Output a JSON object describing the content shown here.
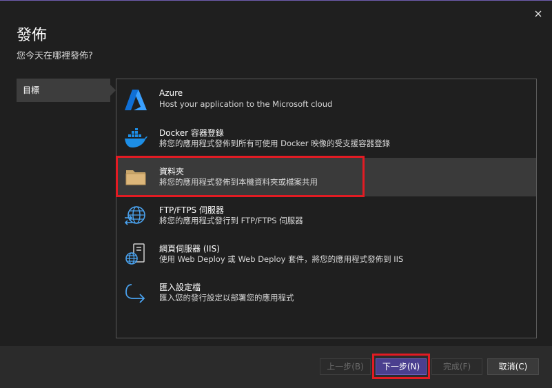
{
  "dialog": {
    "title": "發佈",
    "subtitle": "您今天在哪裡發佈?"
  },
  "nav": {
    "items": [
      {
        "label": "目標"
      }
    ]
  },
  "targets": [
    {
      "name": "Azure",
      "desc": "Host your application to the Microsoft cloud",
      "icon": "azure-icon"
    },
    {
      "name": "Docker 容器登錄",
      "desc": "將您的應用程式發佈到所有可使用 Docker 映像的受支援容器登錄",
      "icon": "docker-icon"
    },
    {
      "name": "資料夾",
      "desc": "將您的應用程式發佈到本機資料夾或檔案共用",
      "icon": "folder-icon",
      "selected": true
    },
    {
      "name": "FTP/FTPS 伺服器",
      "desc": "將您的應用程式發行到 FTP/FTPS 伺服器",
      "icon": "globe-transfer-icon"
    },
    {
      "name": "網頁伺服器 (IIS)",
      "desc": "使用 Web Deploy 或 Web Deploy 套件，將您的應用程式發佈到 IIS",
      "icon": "web-server-icon"
    },
    {
      "name": "匯入設定檔",
      "desc": "匯入您的發行設定以部署您的應用程式",
      "icon": "import-arrow-icon"
    }
  ],
  "footer": {
    "back_label": "上一步(B)",
    "next_label": "下一步(N)",
    "finish_label": "完成(F)",
    "cancel_label": "取消(C)"
  },
  "colors": {
    "accent": "#4a3f8f",
    "highlight": "#e21b23",
    "azure": "#1e90ff",
    "folder": "#dcb67a"
  }
}
